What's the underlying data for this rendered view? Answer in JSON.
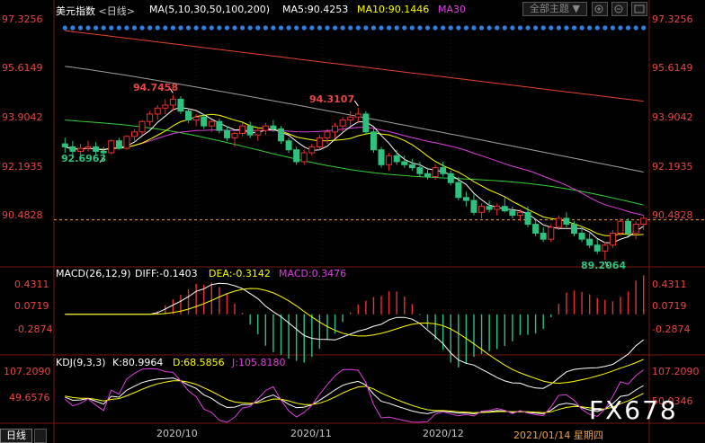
{
  "header": {
    "title": "美元指数",
    "period": "<日线>",
    "ma_label": "MA(5,10,30,50,100,200)",
    "ma5": "MA5:90.4253",
    "ma10": "MA10:90.1446",
    "ma30": "MA30",
    "theme_select": "全部主题",
    "theme_arrow": "▼"
  },
  "macd_header": {
    "label": "MACD(26,12,9)",
    "diff": "DIFF:-0.1403",
    "dea": "DEA:-0.3142",
    "macd": "MACD:0.3476"
  },
  "kdj_header": {
    "label": "KDJ(9,3,3)",
    "k": "K:80.9964",
    "d": "D:68.5856",
    "j": "J:105.8180"
  },
  "footer": {
    "period_label": "日线",
    "date_info": "2021/01/14 星期四",
    "watermark": "FX678"
  },
  "colors": {
    "up": "#e83232",
    "down": "#2ec27e",
    "ma5": "#ffffff",
    "ma10": "#ffff00",
    "ma30": "#e040e0",
    "ma50": "#35d135",
    "ma100": "#a0a0a0",
    "ma200": "#e8412e"
  },
  "chart_data": [
    {
      "type": "candlestick",
      "title": "美元指数 日线",
      "y_ticks": [
        "97.3256",
        "95.6149",
        "93.9042",
        "92.1935",
        "90.4828"
      ],
      "ylim": [
        89.0,
        97.3256
      ],
      "x_ticks": [
        "2020/10",
        "2020/11",
        "2020/12"
      ],
      "annotations": [
        {
          "text": "94.7458",
          "kind": "high"
        },
        {
          "text": "94.3107",
          "kind": "high"
        },
        {
          "text": "92.6963",
          "kind": "low"
        },
        {
          "text": "89.2064",
          "kind": "low"
        }
      ],
      "reference_level": 90.55,
      "candles": [
        [
          93.1,
          93.3,
          92.8,
          93.0
        ],
        [
          93.0,
          93.2,
          92.7,
          92.85
        ],
        [
          92.85,
          93.1,
          92.7,
          92.95
        ],
        [
          92.95,
          93.2,
          92.85,
          93.0
        ],
        [
          93.0,
          93.15,
          92.75,
          92.85
        ],
        [
          92.85,
          93.0,
          92.69,
          92.8
        ],
        [
          92.8,
          93.25,
          92.75,
          93.2
        ],
        [
          93.2,
          93.3,
          92.9,
          92.95
        ],
        [
          92.95,
          93.4,
          92.9,
          93.35
        ],
        [
          93.35,
          93.6,
          93.2,
          93.5
        ],
        [
          93.5,
          93.9,
          93.4,
          93.85
        ],
        [
          93.85,
          94.2,
          93.7,
          94.1
        ],
        [
          94.1,
          94.4,
          93.9,
          94.3
        ],
        [
          94.3,
          94.6,
          94.1,
          94.4
        ],
        [
          94.4,
          94.7458,
          94.2,
          94.6
        ],
        [
          94.6,
          94.7,
          94.1,
          94.2
        ],
        [
          94.2,
          94.3,
          93.8,
          93.9
        ],
        [
          93.9,
          94.1,
          93.7,
          94.0
        ],
        [
          94.0,
          94.1,
          93.6,
          93.7
        ],
        [
          93.7,
          93.9,
          93.5,
          93.85
        ],
        [
          93.85,
          93.95,
          93.45,
          93.55
        ],
        [
          93.55,
          93.7,
          93.2,
          93.3
        ],
        [
          93.3,
          93.5,
          93.0,
          93.45
        ],
        [
          93.45,
          93.8,
          93.35,
          93.7
        ],
        [
          93.7,
          93.85,
          93.3,
          93.4
        ],
        [
          93.4,
          93.6,
          93.2,
          93.55
        ],
        [
          93.55,
          93.8,
          93.4,
          93.7
        ],
        [
          93.7,
          93.9,
          93.5,
          93.6
        ],
        [
          93.6,
          93.7,
          93.1,
          93.2
        ],
        [
          93.2,
          93.3,
          92.8,
          92.9
        ],
        [
          92.9,
          93.0,
          92.4,
          92.5
        ],
        [
          92.5,
          92.9,
          92.4,
          92.8
        ],
        [
          92.8,
          93.1,
          92.7,
          93.0
        ],
        [
          93.0,
          93.4,
          92.9,
          93.3
        ],
        [
          93.3,
          93.6,
          93.1,
          93.5
        ],
        [
          93.5,
          93.8,
          93.3,
          93.7
        ],
        [
          93.7,
          94.0,
          93.5,
          93.9
        ],
        [
          93.9,
          94.2,
          93.7,
          94.0
        ],
        [
          94.0,
          94.3107,
          93.8,
          94.1
        ],
        [
          94.1,
          94.2,
          93.4,
          93.5
        ],
        [
          93.5,
          93.6,
          92.8,
          92.9
        ],
        [
          92.9,
          93.0,
          92.3,
          92.4
        ],
        [
          92.4,
          92.8,
          92.2,
          92.7
        ],
        [
          92.7,
          92.9,
          92.4,
          92.5
        ],
        [
          92.5,
          92.7,
          92.3,
          92.4
        ],
        [
          92.4,
          92.6,
          92.2,
          92.3
        ],
        [
          92.3,
          92.5,
          92.0,
          92.1
        ],
        [
          92.1,
          92.3,
          91.9,
          92.0
        ],
        [
          92.0,
          92.4,
          91.9,
          92.3
        ],
        [
          92.3,
          92.5,
          92.0,
          92.1
        ],
        [
          92.1,
          92.2,
          91.7,
          91.8
        ],
        [
          91.8,
          92.0,
          91.2,
          91.3
        ],
        [
          91.3,
          91.5,
          91.0,
          91.2
        ],
        [
          91.2,
          91.4,
          90.7,
          90.8
        ],
        [
          90.8,
          91.1,
          90.6,
          91.0
        ],
        [
          91.0,
          91.2,
          90.8,
          90.9
        ],
        [
          90.9,
          91.1,
          90.7,
          91.0
        ],
        [
          91.0,
          91.3,
          90.8,
          90.85
        ],
        [
          90.85,
          91.0,
          90.6,
          90.7
        ],
        [
          90.7,
          90.9,
          90.5,
          90.8
        ],
        [
          90.8,
          91.0,
          90.3,
          90.4
        ],
        [
          90.4,
          90.6,
          90.0,
          90.1
        ],
        [
          90.1,
          90.3,
          89.8,
          89.9
        ],
        [
          89.9,
          90.4,
          89.8,
          90.3
        ],
        [
          90.3,
          90.7,
          90.2,
          90.6
        ],
        [
          90.6,
          90.8,
          90.3,
          90.4
        ],
        [
          90.4,
          90.5,
          90.0,
          90.1
        ],
        [
          90.1,
          90.3,
          89.8,
          89.9
        ],
        [
          89.9,
          90.1,
          89.6,
          89.7
        ],
        [
          89.7,
          89.9,
          89.4,
          89.5
        ],
        [
          89.5,
          89.8,
          89.2064,
          89.7
        ],
        [
          89.7,
          90.2,
          89.6,
          90.1
        ],
        [
          90.1,
          90.6,
          90.0,
          90.5
        ],
        [
          90.5,
          90.6,
          90.0,
          90.1
        ],
        [
          90.1,
          90.5,
          89.9,
          90.4
        ],
        [
          90.4,
          90.7,
          90.2,
          90.6
        ]
      ]
    },
    {
      "type": "bar",
      "title": "MACD(26,12,9)",
      "y_ticks": [
        "0.4311",
        "0.0719",
        "-0.2874"
      ],
      "ylim": [
        -0.55,
        0.52
      ]
    },
    {
      "type": "line",
      "title": "KDJ(9,3,3)",
      "y_ticks": [
        "107.2090",
        "49.6576"
      ],
      "right_ticks": [
        "107.2090",
        "50.0346"
      ],
      "ylim": [
        -10,
        115
      ]
    }
  ]
}
